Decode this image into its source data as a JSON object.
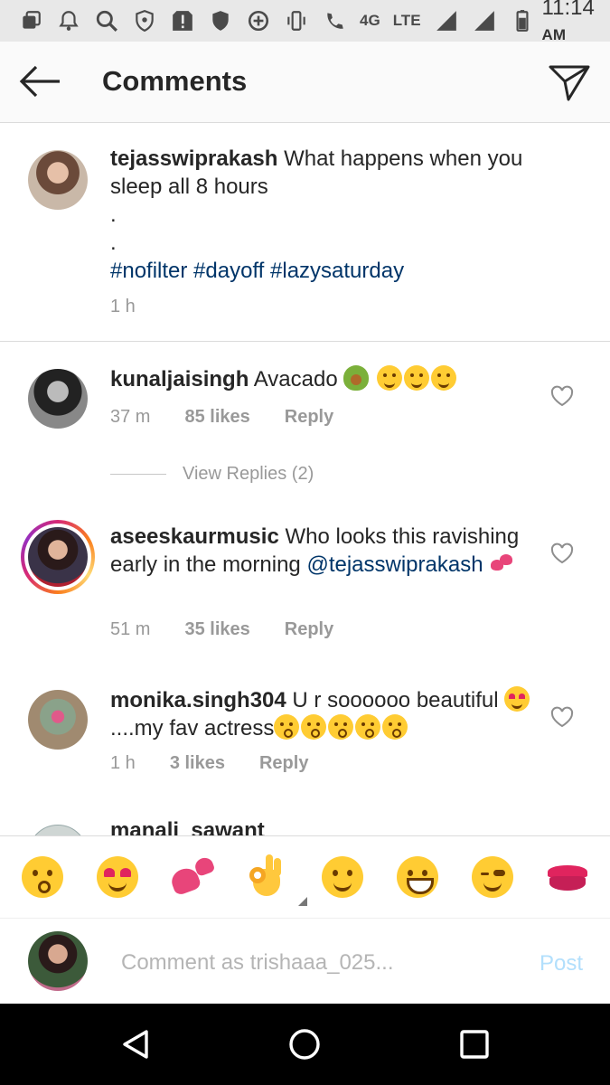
{
  "status_bar": {
    "network_type": "4G",
    "network_label": "LTE",
    "time": "11:14",
    "ampm": "AM"
  },
  "header": {
    "title": "Comments"
  },
  "caption": {
    "username": "tejasswiprakash",
    "text": "What happens when you sleep all 8 hours",
    "dots": [
      ".",
      "."
    ],
    "hashtags": "#nofilter #dayoff #lazysaturday",
    "time": "1 h"
  },
  "comments": [
    {
      "username": "kunaljaisingh",
      "text": "Avacado",
      "time": "37 m",
      "likes": "85 likes",
      "reply": "Reply",
      "view_replies": "View Replies (2)"
    },
    {
      "username": "aseeskaurmusic",
      "text": "Who looks this ravishing early in the morning",
      "mention": "@tejasswiprakash",
      "time": "51 m",
      "likes": "35 likes",
      "reply": "Reply"
    },
    {
      "username": "monika.singh304",
      "text": "U r soooooo beautiful",
      "text2": "....my fav actress",
      "time": "1 h",
      "likes": "3 likes",
      "reply": "Reply"
    },
    {
      "username": "manali_sawant"
    }
  ],
  "emoji_bar": {
    "items": [
      "kissing-heart",
      "heart-eyes",
      "two-hearts",
      "ok-hand",
      "smiling",
      "grinning",
      "winking",
      "kiss-mark"
    ]
  },
  "comment_input": {
    "placeholder": "Comment as trishaaa_025...",
    "post_label": "Post"
  },
  "colors": {
    "link": "#003569",
    "meta": "#999999",
    "post_disabled": "#b2dffc",
    "status_bar_bg": "#e8e8e8"
  }
}
